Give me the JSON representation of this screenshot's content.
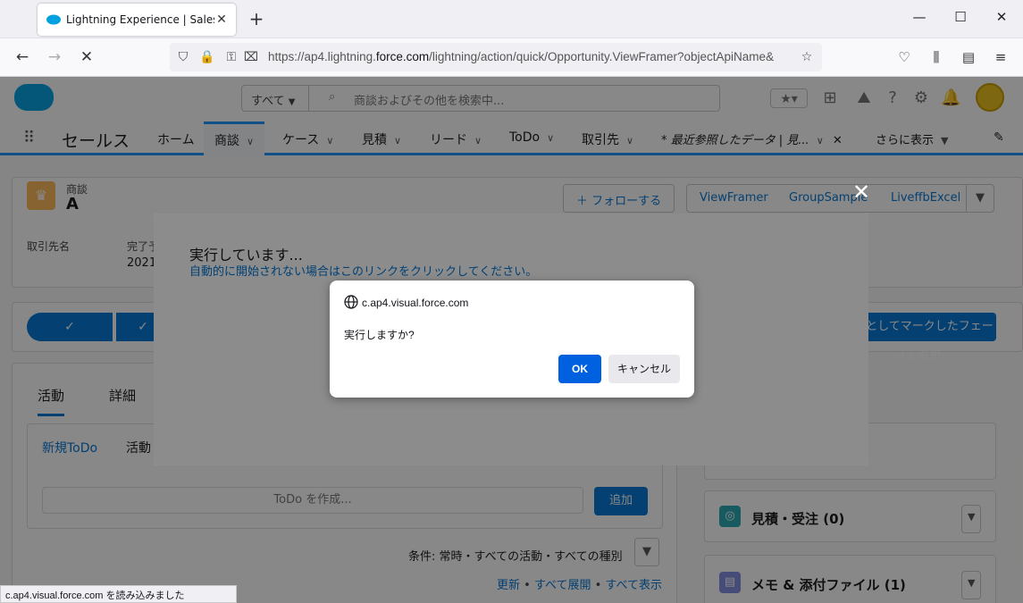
{
  "browser": {
    "tab_title": "Lightning Experience | Salesforce",
    "url_prefix": "https://ap4.lightning.",
    "url_domain": "force.com",
    "url_rest": "/lightning/action/quick/Opportunity.ViewFramer?objectApiName&",
    "status_text": "c.ap4.visual.force.com を読み込みました"
  },
  "sf": {
    "search_scope": "すべて",
    "search_placeholder": "商談およびその他を検索中...",
    "app_name": "セールス",
    "nav": [
      "ホーム",
      "商談",
      "ケース",
      "見積",
      "リード",
      "ToDo",
      "取引先",
      "* 最近参照したデータ | 見...",
      "さらに表示"
    ],
    "record_type": "商談",
    "record_name": "A",
    "follow_button": "フォローする",
    "action_buttons": [
      "ViewFramer",
      "GroupSample",
      "LiveffbExcel"
    ],
    "field_label_account": "取引先名",
    "field_label_close": "完了予定日",
    "field_value_close": "2021",
    "mark_stage_button": "完了としてマークしたフェーズを変更",
    "tab_activity": "活動",
    "tab_detail": "詳細",
    "new_todo": "新規ToDo",
    "activity_sub": "活動",
    "todo_placeholder": "ToDo を作成...",
    "add_button": "追加",
    "filter_text": "条件: 常時・すべての活動・すべての種別",
    "refresh_link": "更新",
    "expand_link": "すべて展開",
    "show_all_link": "すべて表示",
    "related_quotes": "見積・受注 (0)",
    "related_notes": "メモ & 添付ファイル (1)"
  },
  "sf_modal": {
    "title": "実行しています...",
    "link": "自動的に開始されない場合はこのリンクをクリックしてください。"
  },
  "confirm": {
    "origin": "c.ap4.visual.force.com",
    "message": "実行しますか?",
    "ok": "OK",
    "cancel": "キャンセル"
  },
  "colors": {
    "accent": "#0176d3",
    "ok_button": "#0061e0"
  }
}
